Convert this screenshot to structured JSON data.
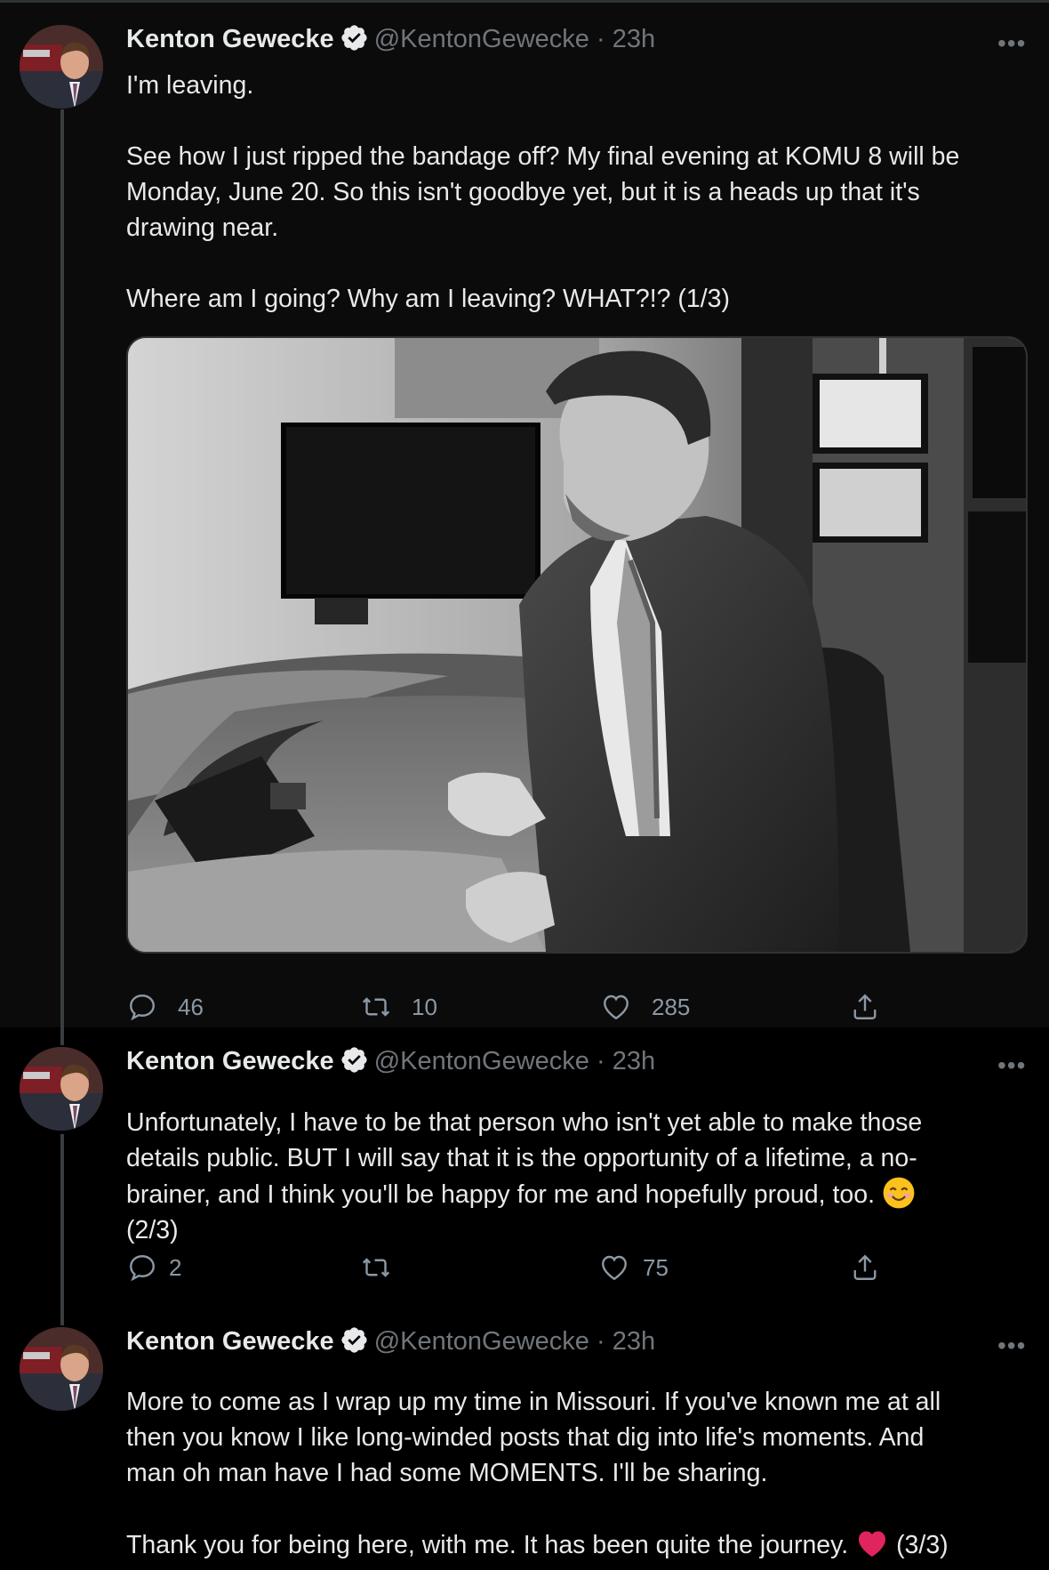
{
  "tweets": [
    {
      "author_name": "Kenton Gewecke",
      "handle": "@KentonGewecke",
      "time": "· 23h",
      "text_lines": [
        "I'm leaving.",
        "",
        "See how I just ripped the bandage off? My final evening at KOMU 8 will be",
        "Monday, June 20. So this isn't goodbye yet, but it is a heads up that it's",
        "drawing near.",
        "",
        "Where am I going? Why am I leaving? WHAT?!? (1/3)"
      ],
      "replies": "46",
      "retweets": "10",
      "likes": "285"
    },
    {
      "author_name": "Kenton Gewecke",
      "handle": "@KentonGewecke",
      "time": "· 23h",
      "text_lines": [
        "Unfortunately, I have to be that person who isn't yet able to make those",
        "details public. BUT I will say that it is the opportunity of a lifetime, a no-",
        "brainer, and I think you'll be happy for me and hopefully proud, too.",
        "(2/3)"
      ],
      "replies": "2",
      "retweets": "",
      "likes": "75"
    },
    {
      "author_name": "Kenton Gewecke",
      "handle": "@KentonGewecke",
      "time": "· 23h",
      "text_lines": [
        "More to come as I wrap up my time in Missouri. If you've known me at all",
        "then you know I like long-winded posts that dig into life's moments. And",
        "man oh man have I had some MOMENTS. I'll be sharing.",
        "",
        "Thank you for being here, with me. It has been quite the journey.",
        "(3/3)"
      ]
    }
  ],
  "more_label": "•••",
  "icons": {
    "verified": "verified-badge-icon",
    "reply": "reply-icon",
    "retweet": "retweet-icon",
    "like": "heart-icon",
    "share": "share-icon",
    "smile": "smiling-face-emoji",
    "heart": "red-heart-emoji"
  },
  "colors": {
    "background": "#000000",
    "text": "#e7e9ea",
    "muted": "#71767b",
    "heart_emoji": "#e0245e"
  }
}
